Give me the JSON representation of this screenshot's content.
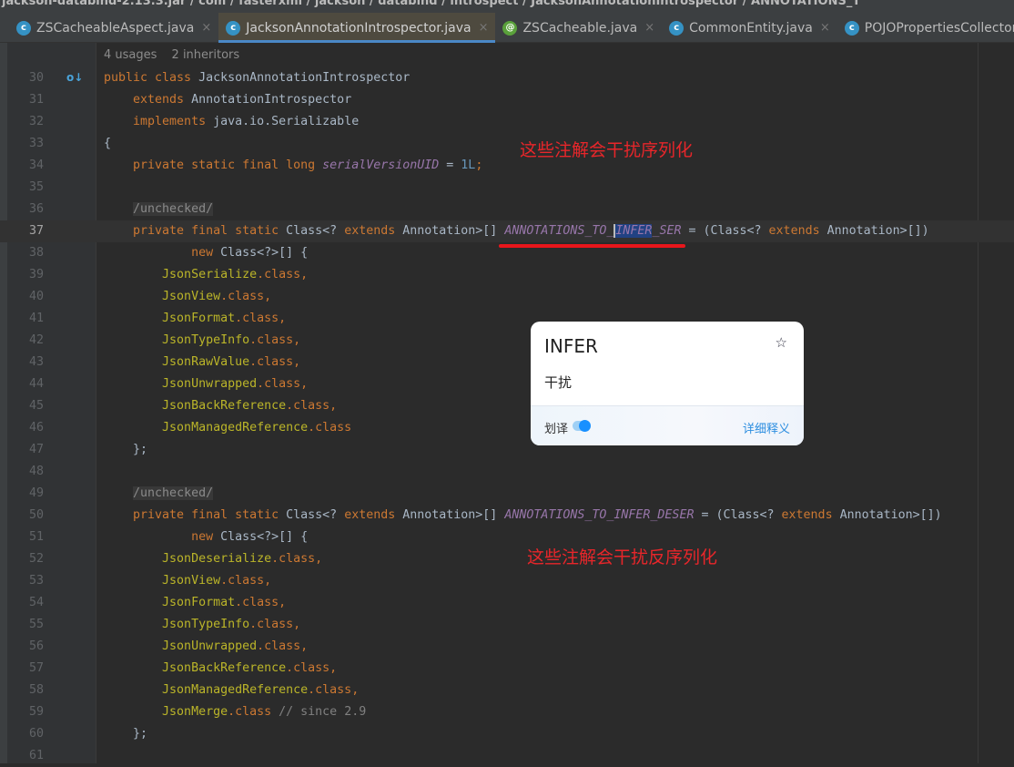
{
  "breadcrumb": "jackson-databind-2.13.3.jar / com / fasterxml / jackson / databind / introspect / JacksonAnnotationIntrospector / ANNOTATIONS_T",
  "tabs": [
    {
      "label": "ZSCacheableAspect.java",
      "icon": "class-icon",
      "active": false
    },
    {
      "label": "JacksonAnnotationIntrospector.java",
      "icon": "class-icon",
      "active": true
    },
    {
      "label": "ZSCacheable.java",
      "icon": "annotation-icon",
      "active": false
    },
    {
      "label": "CommonEntity.java",
      "icon": "class-icon",
      "active": false
    },
    {
      "label": "POJOPropertiesCollector.java",
      "icon": "class-icon",
      "active": false
    }
  ],
  "hints": {
    "usages": "4 usages",
    "inheritors": "2 inheritors"
  },
  "current_line": 37,
  "lines": [
    {
      "n": "30",
      "t": [
        [
          "public class ",
          "kw"
        ],
        [
          "JacksonAnnotationIntrospector",
          ""
        ]
      ]
    },
    {
      "n": "31",
      "t": [
        [
          "    extends ",
          "kw"
        ],
        [
          "AnnotationIntrospector",
          ""
        ]
      ]
    },
    {
      "n": "32",
      "t": [
        [
          "    implements ",
          "kw"
        ],
        [
          "java.io.Serializable",
          ""
        ]
      ]
    },
    {
      "n": "33",
      "t": [
        [
          "{",
          ""
        ]
      ]
    },
    {
      "n": "34",
      "t": [
        [
          "    private static final long ",
          "kw"
        ],
        [
          "serialVersionUID",
          "fld"
        ],
        [
          " = ",
          ""
        ],
        [
          "1L",
          "num"
        ],
        [
          ";",
          "kw"
        ]
      ]
    },
    {
      "n": "35",
      "t": []
    },
    {
      "n": "36",
      "t": [
        [
          "    ",
          ""
        ],
        [
          "/unchecked/",
          "tag"
        ]
      ]
    },
    {
      "n": "37",
      "t": [
        [
          "    private final static ",
          "kw"
        ],
        [
          "Class<? ",
          ""
        ],
        [
          "extends ",
          "kw"
        ],
        [
          "Annotation>[] ",
          ""
        ],
        [
          "ANNOTATIONS_TO_",
          "fld"
        ],
        [
          "INFER",
          "fld sel"
        ],
        [
          "_SER",
          "fld"
        ],
        [
          " = (Class<? ",
          ""
        ],
        [
          "extends ",
          "kw"
        ],
        [
          "Annotation>[])",
          ""
        ]
      ]
    },
    {
      "n": "38",
      "t": [
        [
          "            new ",
          "kw"
        ],
        [
          "Class<?>[] {",
          ""
        ]
      ]
    },
    {
      "n": "39",
      "t": [
        [
          "        JsonSerialize",
          "an"
        ],
        [
          ".class,",
          "kw"
        ]
      ]
    },
    {
      "n": "40",
      "t": [
        [
          "        JsonView",
          "an"
        ],
        [
          ".class,",
          "kw"
        ]
      ]
    },
    {
      "n": "41",
      "t": [
        [
          "        JsonFormat",
          "an"
        ],
        [
          ".class,",
          "kw"
        ]
      ]
    },
    {
      "n": "42",
      "t": [
        [
          "        JsonTypeInfo",
          "an"
        ],
        [
          ".class,",
          "kw"
        ]
      ]
    },
    {
      "n": "43",
      "t": [
        [
          "        JsonRawValue",
          "an"
        ],
        [
          ".class,",
          "kw"
        ]
      ]
    },
    {
      "n": "44",
      "t": [
        [
          "        JsonUnwrapped",
          "an"
        ],
        [
          ".class,",
          "kw"
        ]
      ]
    },
    {
      "n": "45",
      "t": [
        [
          "        JsonBackReference",
          "an"
        ],
        [
          ".class,",
          "kw"
        ]
      ]
    },
    {
      "n": "46",
      "t": [
        [
          "        JsonManagedReference",
          "an"
        ],
        [
          ".class",
          "kw"
        ]
      ]
    },
    {
      "n": "47",
      "t": [
        [
          "    };",
          ""
        ]
      ]
    },
    {
      "n": "48",
      "t": []
    },
    {
      "n": "49",
      "t": [
        [
          "    ",
          ""
        ],
        [
          "/unchecked/",
          "tag"
        ]
      ]
    },
    {
      "n": "50",
      "t": [
        [
          "    private final static ",
          "kw"
        ],
        [
          "Class<? ",
          ""
        ],
        [
          "extends ",
          "kw"
        ],
        [
          "Annotation>[] ",
          ""
        ],
        [
          "ANNOTATIONS_TO_INFER_DESER",
          "fld"
        ],
        [
          " = (Class<? ",
          ""
        ],
        [
          "extends ",
          "kw"
        ],
        [
          "Annotation>[])",
          ""
        ]
      ]
    },
    {
      "n": "51",
      "t": [
        [
          "            new ",
          "kw"
        ],
        [
          "Class<?>[] {",
          ""
        ]
      ]
    },
    {
      "n": "52",
      "t": [
        [
          "        JsonDeserialize",
          "an"
        ],
        [
          ".class,",
          "kw"
        ]
      ]
    },
    {
      "n": "53",
      "t": [
        [
          "        JsonView",
          "an"
        ],
        [
          ".class,",
          "kw"
        ]
      ]
    },
    {
      "n": "54",
      "t": [
        [
          "        JsonFormat",
          "an"
        ],
        [
          ".class,",
          "kw"
        ]
      ]
    },
    {
      "n": "55",
      "t": [
        [
          "        JsonTypeInfo",
          "an"
        ],
        [
          ".class,",
          "kw"
        ]
      ]
    },
    {
      "n": "56",
      "t": [
        [
          "        JsonUnwrapped",
          "an"
        ],
        [
          ".class,",
          "kw"
        ]
      ]
    },
    {
      "n": "57",
      "t": [
        [
          "        JsonBackReference",
          "an"
        ],
        [
          ".class,",
          "kw"
        ]
      ]
    },
    {
      "n": "58",
      "t": [
        [
          "        JsonManagedReference",
          "an"
        ],
        [
          ".class,",
          "kw"
        ]
      ]
    },
    {
      "n": "59",
      "t": [
        [
          "        JsonMerge",
          "an"
        ],
        [
          ".class ",
          "kw"
        ],
        [
          "// since 2.9",
          "cm"
        ]
      ]
    },
    {
      "n": "60",
      "t": [
        [
          "    };",
          ""
        ]
      ]
    },
    {
      "n": "61",
      "t": []
    }
  ],
  "annotations": {
    "ser_note": "这些注解会干扰序列化",
    "deser_note": "这些注解会干扰反序列化"
  },
  "popup": {
    "word": "INFER",
    "meaning": "干扰",
    "toggle_label": "划译",
    "toggle_on": true,
    "detail_link": "详细释义"
  },
  "colors": {
    "keyword": "#cc7832",
    "annotation": "#bbb529",
    "field": "#9876aa",
    "number": "#6897bb",
    "note": "#e8262a",
    "accent": "#4a88c7"
  }
}
